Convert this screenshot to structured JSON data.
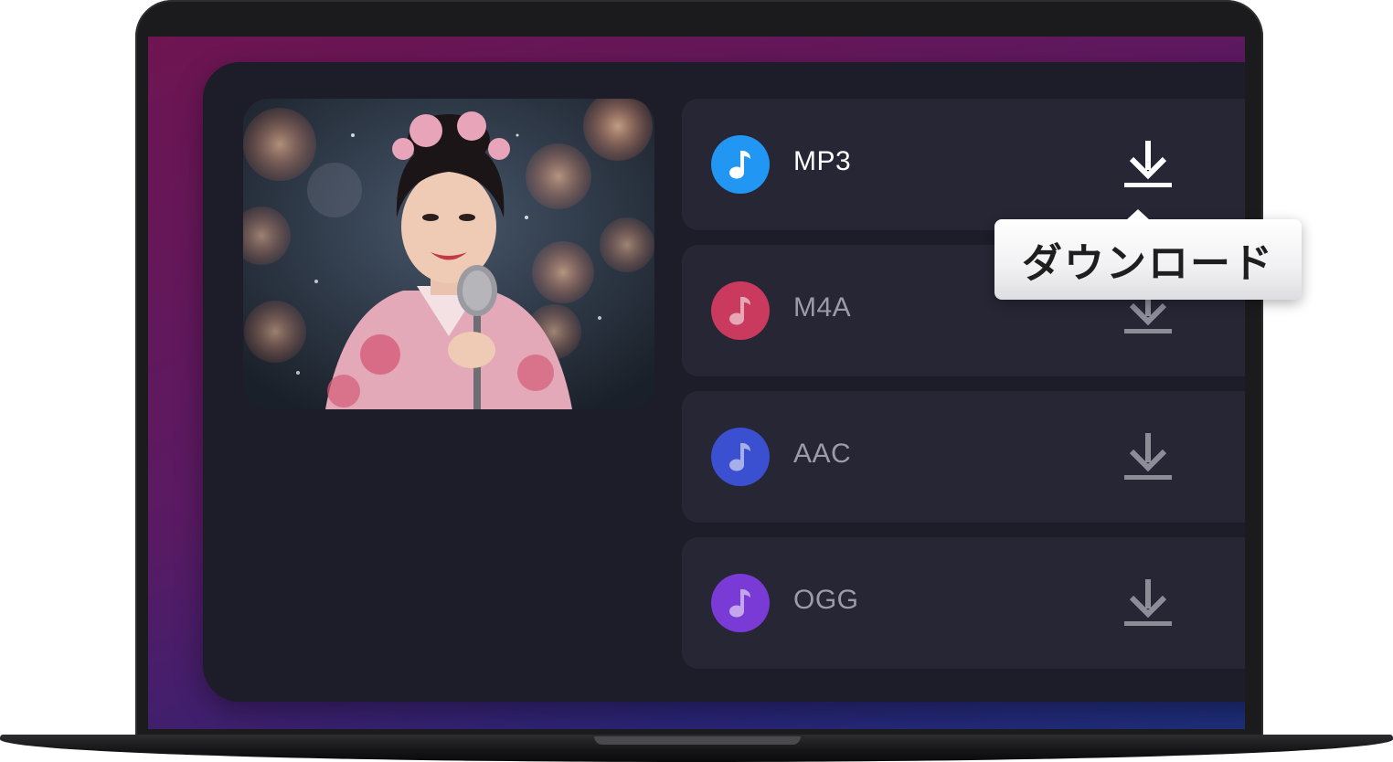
{
  "formats": [
    {
      "label": "MP3",
      "icon": "music-note-icon",
      "color": "#2196f3",
      "active": true
    },
    {
      "label": "M4A",
      "icon": "music-note-icon",
      "color": "#c93a5e",
      "active": false
    },
    {
      "label": "AAC",
      "icon": "music-note-icon",
      "color": "#3b4fd1",
      "active": false
    },
    {
      "label": "OGG",
      "icon": "music-note-icon",
      "color": "#7a3ad6",
      "active": false
    }
  ],
  "download_icon": "download-icon",
  "tooltip": {
    "text": "ダウンロード"
  },
  "colors": {
    "panel": "#1d1c29",
    "row": "#272635",
    "accent": "#2196f3"
  }
}
